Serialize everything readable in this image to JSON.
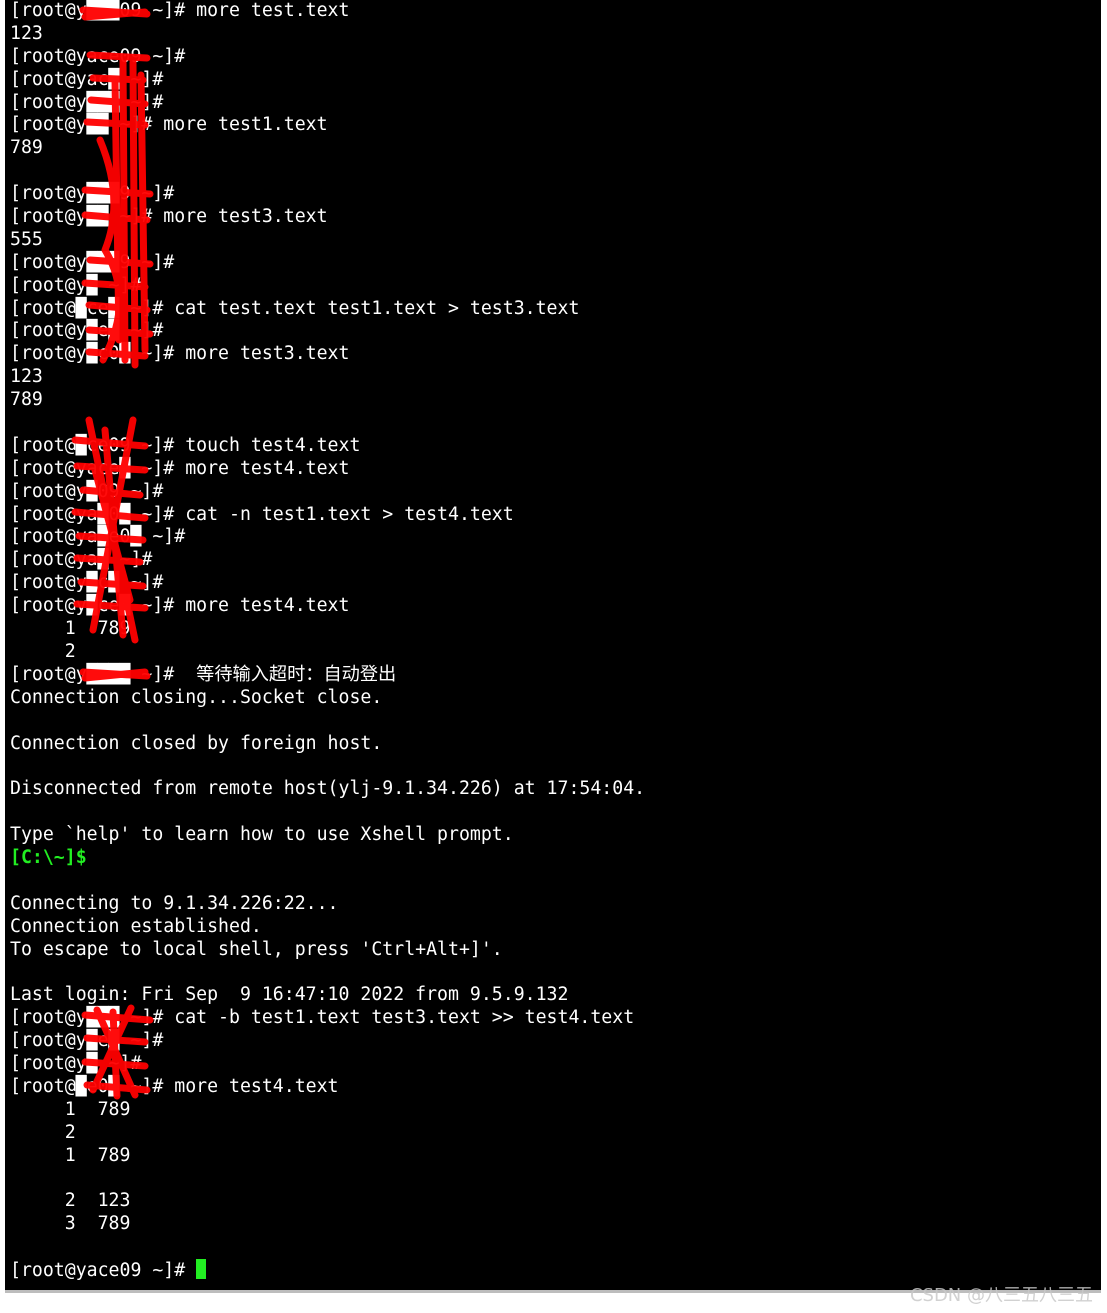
{
  "terminal": {
    "lines": [
      "[root@y███09 ~]# more test.text",
      "123",
      "[root@yace09 ~]#",
      "[root@yac█ ~]#",
      "[root@y███ ~]#",
      "[root@y██ ~]# more test1.text",
      "789",
      "",
      "[root@y███9 ~]#",
      "[root@y██ ~]# more test3.text",
      "555",
      "[root@y███9 ~]#",
      "[root@y█ ~]#",
      "[root@█ce█ ~]# cat test.text test1.text > test3.text",
      "[root@y█e█ ~]#",
      "[root@y█c0█ ~]# more test3.text",
      "123",
      "789",
      "",
      "[root@█ce09 ~]# touch test4.text",
      "[root@yace█ ~]# more test4.text",
      "[root@y█09 ~]#",
      "[root@ya█0█ ~]# cat -n test1.text > test4.text",
      "[root@ya█e0█ ~]#",
      "[root@ya█ ~]#",
      "[root@y█c█ ~]#",
      "[root@y█ce█ ~]# more test4.text",
      "     1  789",
      "     2",
      "[root@y████ ~]#  等待输入超时：自动登出",
      "Connection closing...Socket close.",
      "",
      "Connection closed by foreign host.",
      "",
      "Disconnected from remote host(ylj-9.1.34.226) at 17:54:04.",
      "",
      "Type `help' to learn how to use Xshell prompt.",
      "[C:\\~]$",
      "",
      "Connecting to 9.1.34.226:22...",
      "Connection established.",
      "To escape to local shell, press 'Ctrl+Alt+]'.",
      "",
      "Last login: Fri Sep  9 16:47:10 2022 from 9.5.9.132",
      "[root@y███ ~]# cat -b test1.text test3.text >> test4.text",
      "[root@y█e█ ~]#",
      "[root@y█ ~]#",
      "[root@█e0█ ~]# more test4.text",
      "     1  789",
      "     2",
      "     1  789",
      "",
      "     2  123",
      "     3  789",
      "",
      "[root@yace09 ~]# "
    ],
    "colors": {
      "background": "#000000",
      "text": "#ffffff",
      "local_prompt": "#22ee22",
      "cursor": "#22ee22",
      "redaction": "#ff0000"
    }
  },
  "watermark": "CSDN @八三五八三五"
}
